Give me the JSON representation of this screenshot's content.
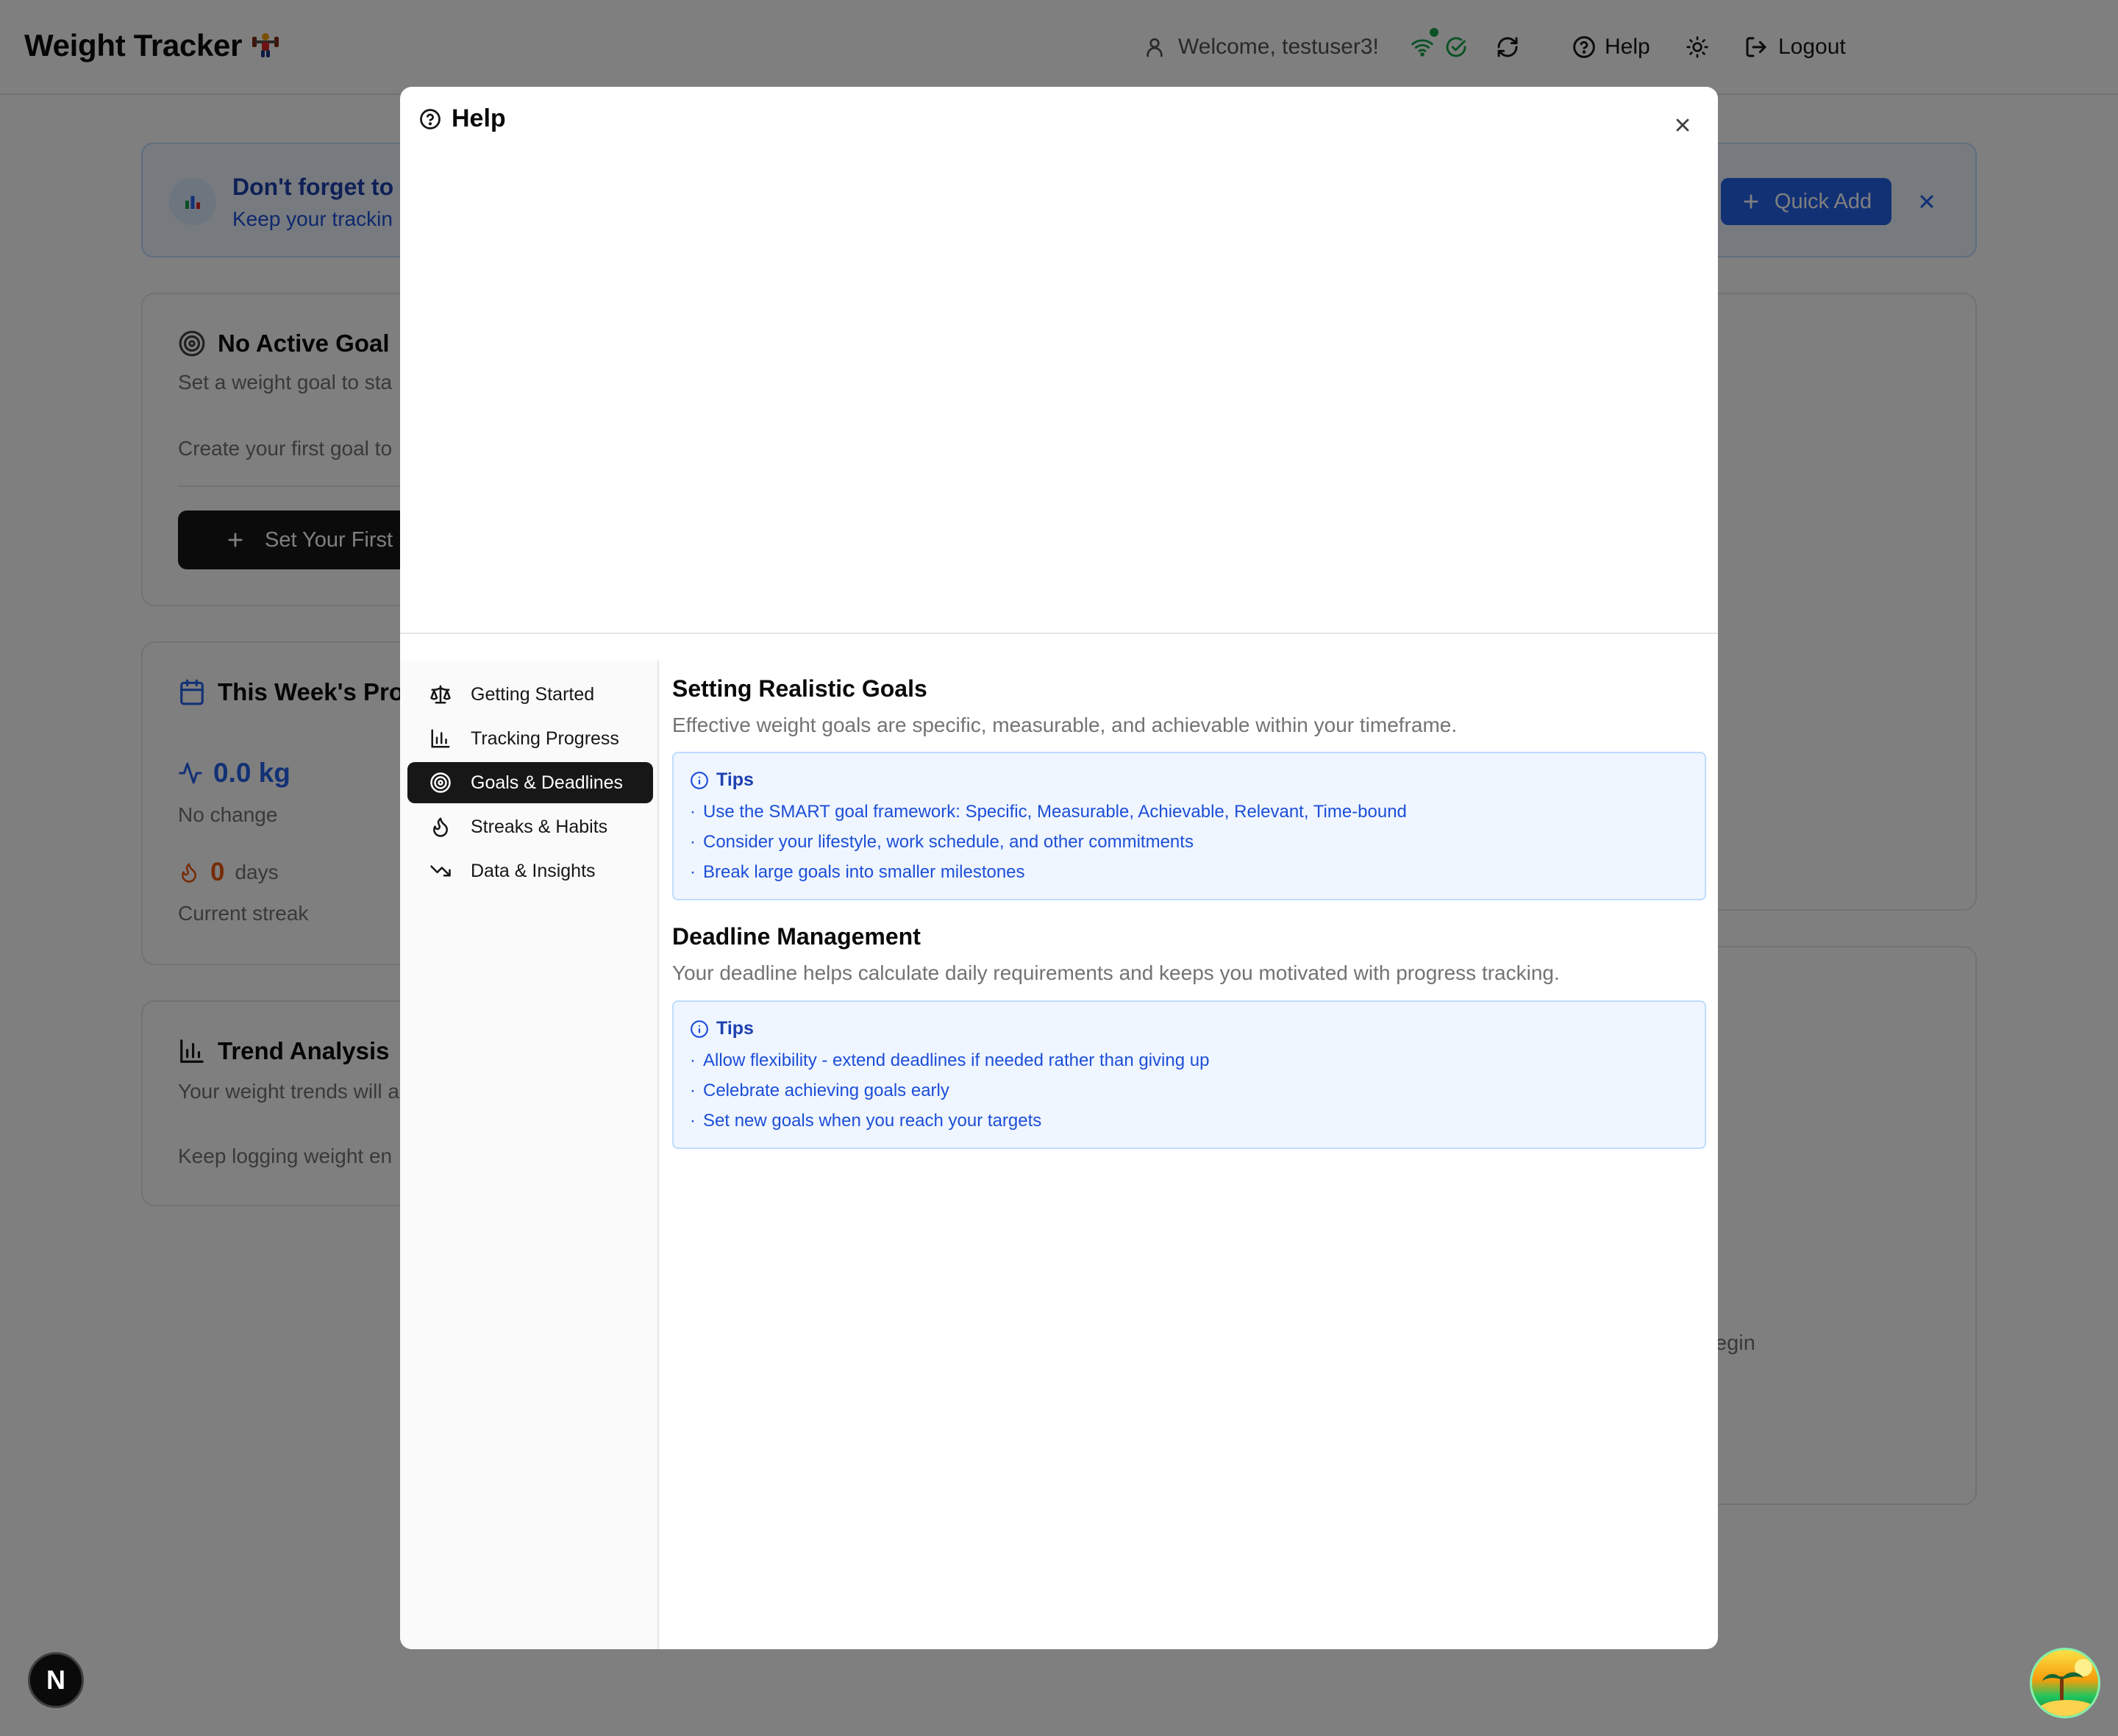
{
  "header": {
    "title": "Weight Tracker",
    "welcome": "Welcome, testuser3!",
    "help_label": "Help",
    "logout_label": "Logout"
  },
  "banner": {
    "title": "Don't forget to l",
    "subtitle": "Keep your trackin",
    "quick_add_label": "Quick Add"
  },
  "goal_card": {
    "title": "No Active Goal",
    "subtitle": "Set a weight goal to sta",
    "body": "Create your first goal to",
    "button_label": "Set Your First"
  },
  "week_card": {
    "title": "This Week's Pro",
    "change_value": "0.0 kg",
    "change_label": "No change",
    "streak_value": "0",
    "streak_unit": "days",
    "streak_label": "Current streak"
  },
  "trend_card": {
    "title": "Trend Analysis",
    "subtitle": "Your weight trends will a",
    "body": "Keep logging weight en"
  },
  "right_card": {
    "partial_text": "egin"
  },
  "help_modal": {
    "title": "Help",
    "nav": [
      {
        "label": "Getting Started",
        "icon": "scale-icon"
      },
      {
        "label": "Tracking Progress",
        "icon": "bar-chart-icon"
      },
      {
        "label": "Goals & Deadlines",
        "icon": "target-icon",
        "active": true
      },
      {
        "label": "Streaks & Habits",
        "icon": "flame-icon"
      },
      {
        "label": "Data & Insights",
        "icon": "trending-down-icon"
      }
    ],
    "sections": [
      {
        "heading": "Setting Realistic Goals",
        "description": "Effective weight goals are specific, measurable, and achievable within your timeframe.",
        "tips_label": "Tips",
        "tips": [
          "Use the SMART goal framework: Specific, Measurable, Achievable, Relevant, Time-bound",
          "Consider your lifestyle, work schedule, and other commitments",
          "Break large goals into smaller milestones"
        ]
      },
      {
        "heading": "Deadline Management",
        "description": "Your deadline helps calculate daily requirements and keeps you motivated with progress tracking.",
        "tips_label": "Tips",
        "tips": [
          "Allow flexibility - extend deadlines if needed rather than giving up",
          "Celebrate achieving goals early",
          "Set new goals when you reach your targets"
        ]
      }
    ]
  },
  "dev_badge": "N",
  "colors": {
    "accent_blue": "#2563eb",
    "tips_bg": "#eff6ff",
    "tips_border": "#bfdbfe",
    "active_nav_bg": "#171717",
    "streak_orange": "#ea580c",
    "online_green": "#16a34a"
  }
}
